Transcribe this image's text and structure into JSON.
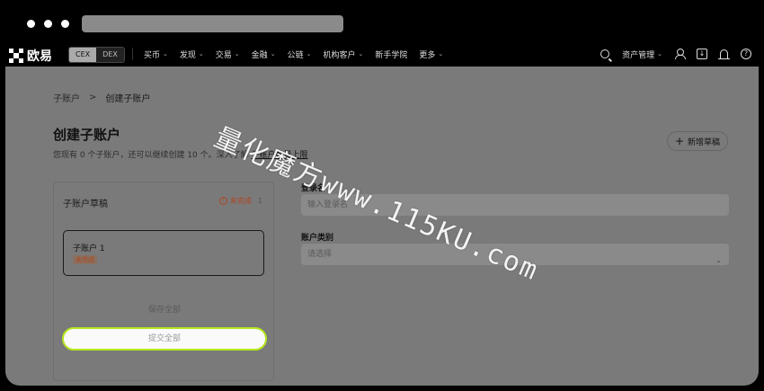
{
  "nav": {
    "logo_text": "欧易",
    "mode_switch": [
      "CEX",
      "DEX"
    ],
    "menu": [
      {
        "label": "买币",
        "has_dropdown": true
      },
      {
        "label": "发现",
        "has_dropdown": true
      },
      {
        "label": "交易",
        "has_dropdown": true
      },
      {
        "label": "金融",
        "has_dropdown": true
      },
      {
        "label": "公链",
        "has_dropdown": true
      },
      {
        "label": "机构客户",
        "has_dropdown": true
      },
      {
        "label": "新手学院",
        "has_dropdown": false
      },
      {
        "label": "更多",
        "has_dropdown": true
      }
    ],
    "asset_management": "资产管理",
    "icons": [
      "search-icon",
      "user-icon",
      "download-icon",
      "bell-icon",
      "help-icon"
    ]
  },
  "breadcrumb": {
    "parent": "子账户",
    "separator": ">",
    "current": "创建子账户"
  },
  "page": {
    "title": "创建子账户",
    "subtitle_prefix": "您现有 0 个子账户，还可以继续创建 10 个。深入了解",
    "subtitle_link": "子账户数量上限",
    "new_draft_label": "新增草稿"
  },
  "drafts": {
    "header": "子账户草稿",
    "status_label": "未完成",
    "status_count": "1",
    "items": [
      {
        "name": "子账户 1",
        "status": "未完成"
      }
    ],
    "save_all": "保存全部",
    "submit_all": "提交全部"
  },
  "form": {
    "login_label": "登录名",
    "login_placeholder": "输入登录名",
    "type_label": "账户类别",
    "type_placeholder": "请选择"
  },
  "watermark": "量化魔方www.115KU.com",
  "colors": {
    "submit_border": "#b5e61d",
    "status_warning": "#b0451f",
    "overlay": "#7a7a7a"
  }
}
